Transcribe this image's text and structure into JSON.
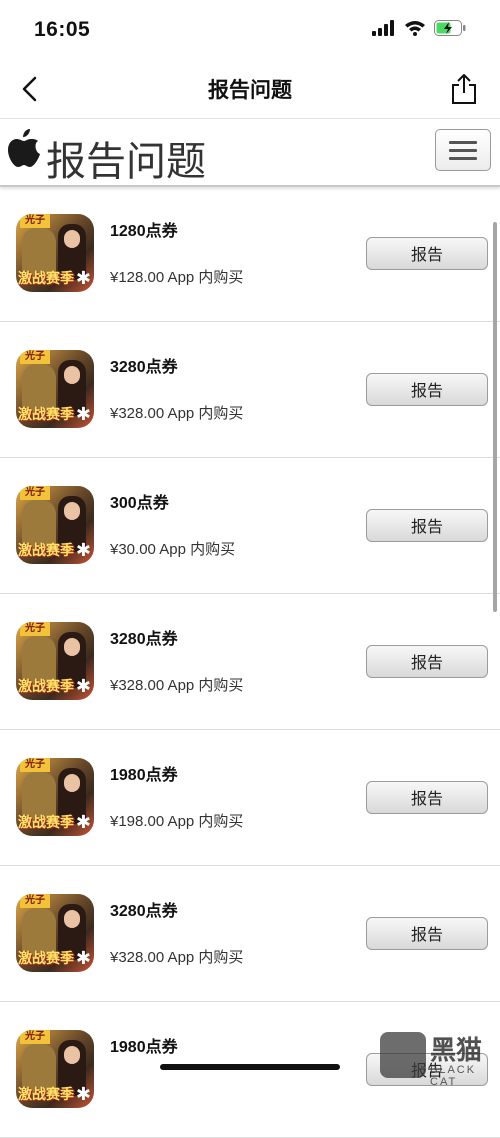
{
  "status_bar": {
    "time": "16:05"
  },
  "nav_bar": {
    "title": "报告问题"
  },
  "site_header": {
    "title": "报告问题"
  },
  "items": [
    {
      "name": "1280点券",
      "price": "¥128.00 App 内购买",
      "button": "报告"
    },
    {
      "name": "3280点券",
      "price": "¥328.00 App 内购买",
      "button": "报告"
    },
    {
      "name": "300点券",
      "price": "¥30.00 App 内购买",
      "button": "报告"
    },
    {
      "name": "3280点券",
      "price": "¥328.00 App 内购买",
      "button": "报告"
    },
    {
      "name": "1980点券",
      "price": "¥198.00 App 内购买",
      "button": "报告"
    },
    {
      "name": "3280点券",
      "price": "¥328.00 App 内购买",
      "button": "报告"
    },
    {
      "name": "1980点券",
      "price": "",
      "button": "报告"
    }
  ],
  "app_icon": {
    "banner": "光子",
    "text": "激战赛季"
  },
  "watermark": {
    "main": "黑猫",
    "sub": "BLACK CAT"
  },
  "icons": [
    "signal-icon",
    "wifi-icon",
    "battery-charging-icon",
    "back-chevron-icon",
    "share-icon",
    "apple-logo-icon",
    "hamburger-menu-icon"
  ],
  "colors": {
    "button_border": "#9c9c9c",
    "divider": "#dcdcdc",
    "battery_green": "#4cd964"
  }
}
